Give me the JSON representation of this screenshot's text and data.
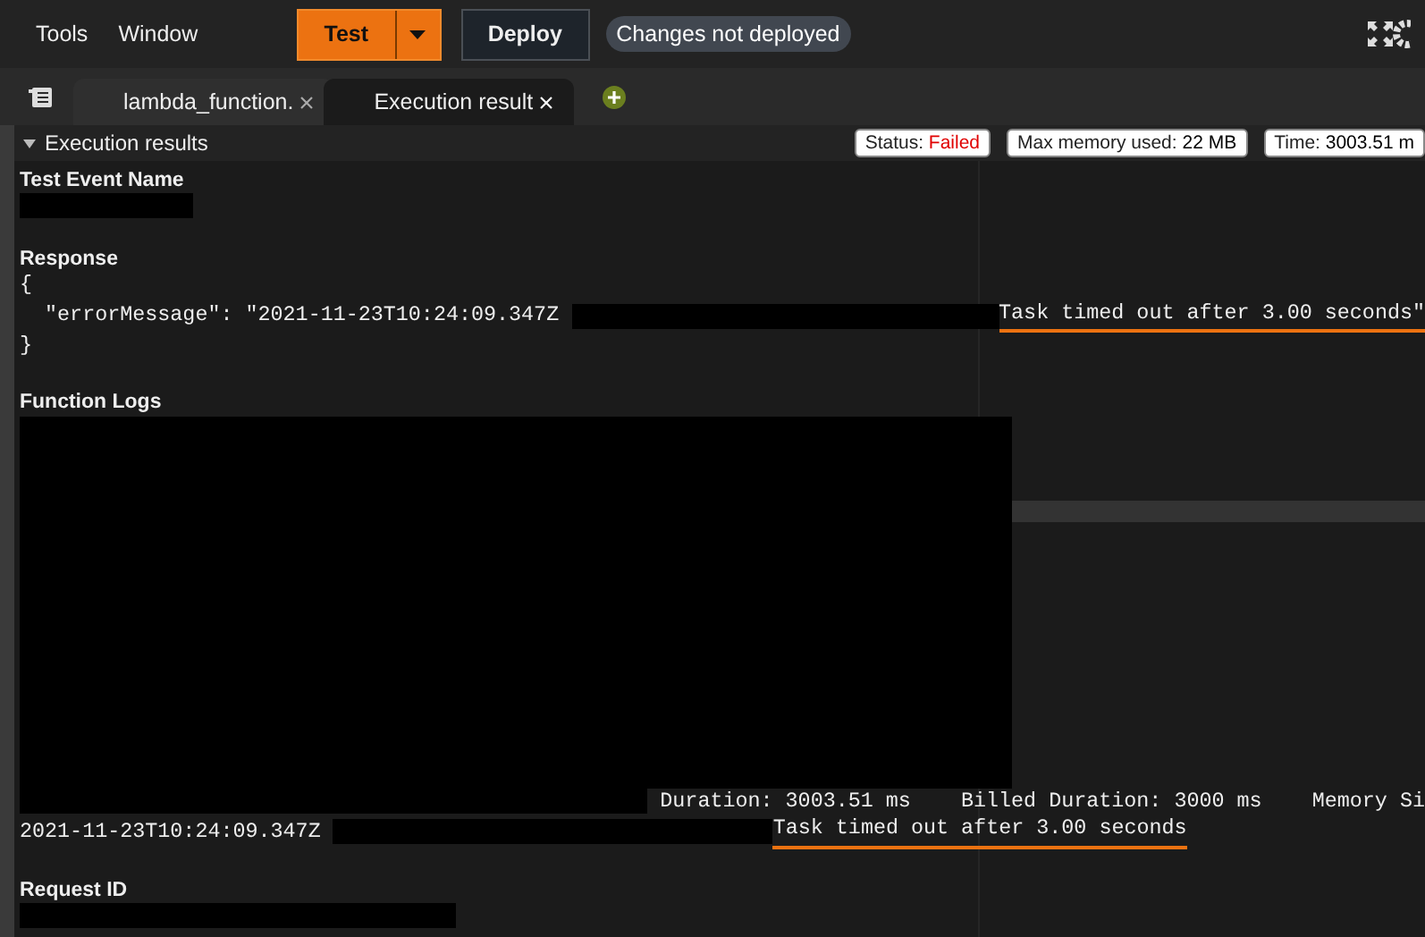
{
  "menu": [
    "Tools",
    "Window"
  ],
  "toolbar": {
    "test_button": "Test",
    "deploy_button": "Deploy",
    "status_badge": "Changes not deployed"
  },
  "tabs": [
    {
      "label": "lambda_function.",
      "selected": false
    },
    {
      "label": "Execution result",
      "selected": true
    }
  ],
  "panel": {
    "title": "Execution results",
    "expanded": true,
    "badges": [
      {
        "label": "Status: ",
        "value": "Failed",
        "kind": "status"
      },
      {
        "label": "Max memory used: ",
        "value": "22 MB",
        "kind": "plain"
      },
      {
        "label": "Time: ",
        "value": "3003.51 m",
        "kind": "plain"
      }
    ]
  },
  "sections": [
    {
      "heading": "Test Event Name",
      "lines": [
        [
          {
            "kind": "redacted"
          }
        ]
      ]
    },
    {
      "heading": "Response",
      "lines": [
        [
          {
            "kind": "text",
            "text": "{"
          }
        ],
        [
          {
            "kind": "text",
            "text": "  \"errorMessage\": \"2021-11-23T10:24:09.347Z "
          },
          {
            "kind": "redacted"
          },
          {
            "kind": "highlight",
            "text": "Task timed out after 3.00 seconds\""
          }
        ],
        [
          {
            "kind": "text",
            "text": "}"
          }
        ]
      ]
    },
    {
      "heading": "Function Logs",
      "lines": [
        [
          {
            "kind": "redacted-block"
          }
        ],
        [
          {
            "kind": "redacted"
          },
          {
            "kind": "text",
            "text": " Duration: 3003.51 ms    Billed Duration: 3000 ms    Memory Si"
          }
        ],
        [
          {
            "kind": "text",
            "text": "2021-11-23T10:24:09.347Z "
          },
          {
            "kind": "redacted"
          },
          {
            "kind": "highlight",
            "text": "Task timed out after 3.00 seconds"
          }
        ]
      ]
    },
    {
      "heading": "Request ID",
      "lines": [
        [
          {
            "kind": "redacted"
          }
        ]
      ]
    }
  ]
}
